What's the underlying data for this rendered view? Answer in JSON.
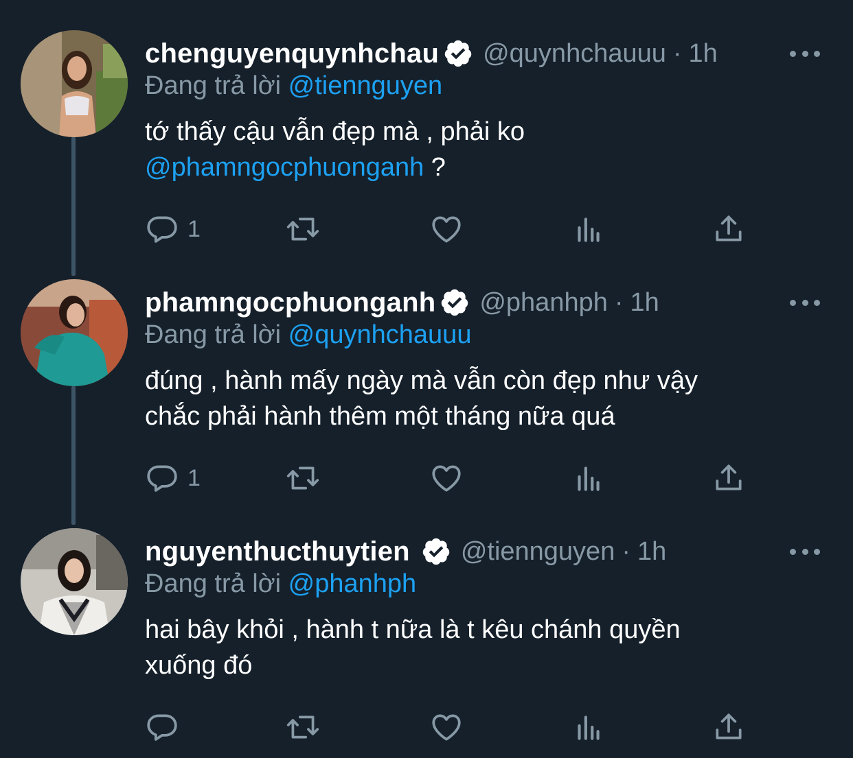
{
  "colors": {
    "background": "#15202b",
    "text": "#ffffff",
    "secondary": "#8899a6",
    "link": "#1da1f2",
    "thread_line": "#3d5466"
  },
  "tweets": [
    {
      "name": "chenguyenquynhchau",
      "handle": "@quynhchauuu",
      "separator": "·",
      "time": "1h",
      "replying_prefix": "Đang trả lời",
      "replying_to": "@tiennguyen",
      "text_line1": "tớ thấy cậu vẫn đẹp mà , phải ko",
      "mention": "@phamngocphuonganh",
      "text_suffix": " ?",
      "reply_count": "1",
      "icons": [
        "verified-icon",
        "more-icon",
        "reply-icon",
        "retweet-icon",
        "like-icon",
        "analytics-icon",
        "share-icon"
      ]
    },
    {
      "name": "phamngocphuonganh",
      "handle": "@phanhph",
      "separator": "·",
      "time": "1h",
      "replying_prefix": "Đang trả lời",
      "replying_to": "@quynhchauuu",
      "text_line1": "đúng , hành mấy ngày mà vẫn còn đẹp như vậy",
      "text_line2": "chắc phải hành thêm một tháng nữa quá",
      "reply_count": "1"
    },
    {
      "name": "nguyenthucthuytien",
      "handle": "@tiennguyen",
      "separator": "·",
      "time": "1h",
      "replying_prefix": "Đang trả lời",
      "replying_to": "@phanhph",
      "text_line1": "hai bây khỏi , hành t nữa là t kêu chánh quyền",
      "text_line2": "xuống đó",
      "reply_count": ""
    }
  ]
}
